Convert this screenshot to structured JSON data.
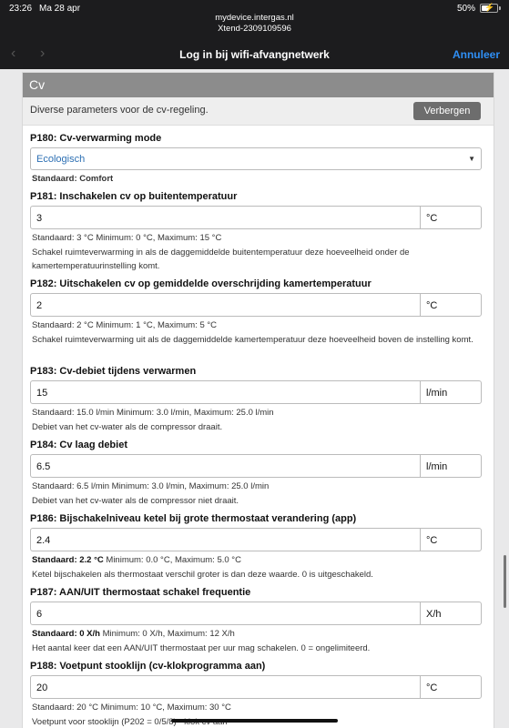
{
  "status": {
    "time": "23:26",
    "date": "Ma 28 apr",
    "battery": "50%",
    "battery_level": 0.5
  },
  "url": {
    "host": "mydevice.intergas.nl",
    "device": "Xtend-2309109596"
  },
  "nav": {
    "title": "Log in bij wifi-afvangnetwerk",
    "cancel": "Annuleer",
    "back_icon": "chevron-left-icon",
    "forward_icon": "chevron-right-icon"
  },
  "section": {
    "title": "Cv",
    "description": "Diverse parameters voor de cv-regeling.",
    "hide_button": "Verbergen"
  },
  "params": [
    {
      "code_label": "P180: Cv-verwarming mode",
      "selected": "Ecologisch",
      "default_label": "Standaard:",
      "default_value": "Comfort"
    },
    {
      "code_label": "P181: Inschakelen cv op buitentemperatuur",
      "value": "3",
      "unit": "°C",
      "meta": "Standaard: 3 °C Minimum: 0 °C, Maximum: 15 °C",
      "desc": "Schakel ruimteverwarming in als de daggemiddelde buitentemperatuur deze hoeveelheid onder de kamertemperatuurinstelling komt."
    },
    {
      "code_label": "P182: Uitschakelen cv op gemiddelde overschrijding kamertemperatuur",
      "value": "2",
      "unit": "°C",
      "meta": "Standaard: 2 °C Minimum: 1 °C, Maximum: 5 °C",
      "desc": "Schakel ruimteverwarming uit als de daggemiddelde kamertemperatuur deze hoeveelheid boven de instelling komt."
    },
    {
      "code_label": "P183: Cv-debiet tijdens verwarmen",
      "value": "15",
      "unit": "l/min",
      "meta": "Standaard: 15.0 l/min Minimum: 3.0 l/min, Maximum: 25.0 l/min",
      "desc": "Debiet van het cv-water als de compressor draait."
    },
    {
      "code_label": "P184: Cv laag debiet",
      "value": "6.5",
      "unit": "l/min",
      "meta": "Standaard: 6.5 l/min Minimum: 3.0 l/min, Maximum: 25.0 l/min",
      "desc": "Debiet van het cv-water als de compressor niet draait."
    },
    {
      "code_label": "P186: Bijschakelniveau ketel bij grote thermostaat verandering (app)",
      "value": "2.4",
      "unit": "°C",
      "meta_bold": "Standaard: 2.2 °C",
      "meta": " Minimum: 0.0 °C, Maximum: 5.0 °C",
      "desc": "Ketel bijschakelen als thermostaat verschil groter is dan deze waarde. 0 is uitgeschakeld."
    },
    {
      "code_label": "P187: AAN/UIT thermostaat schakel frequentie",
      "value": "6",
      "unit": "X/h",
      "meta_bold": "Standaard: 0 X/h",
      "meta": " Minimum: 0 X/h, Maximum: 12 X/h",
      "desc": "Het aantal keer dat een AAN/UIT thermostaat per uur mag schakelen. 0 = ongelimiteerd."
    },
    {
      "code_label": "P188: Voetpunt stooklijn (cv-klokprogramma aan)",
      "value": "20",
      "unit": "°C",
      "meta": "Standaard: 20 °C Minimum: 10 °C, Maximum: 30 °C",
      "desc": "Voetpunt voor stooklijn (P202 = 0/5/8) - klok cv aan"
    }
  ]
}
